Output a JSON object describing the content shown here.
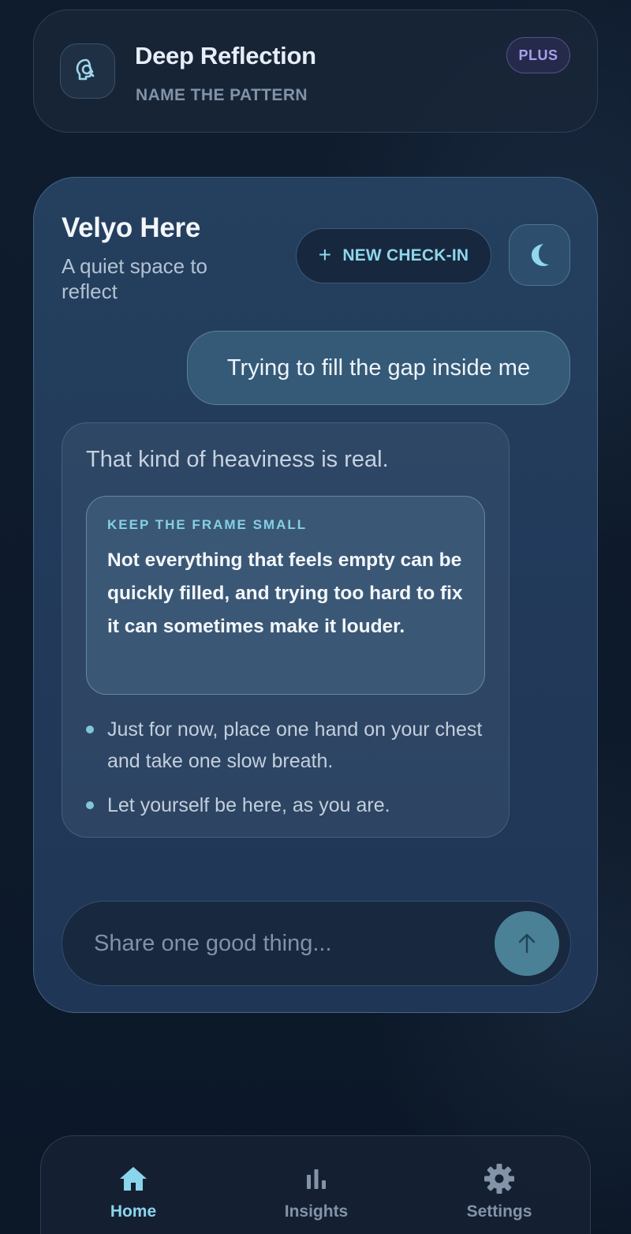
{
  "header": {
    "icon": "brain-search-icon",
    "title": "Deep Reflection",
    "subtitle": "NAME THE PATTERN",
    "badge": "PLUS"
  },
  "chat": {
    "title": "Velyo Here",
    "subtitle": "A quiet space to reflect",
    "new_checkin_label": "NEW CHECK-IN",
    "new_checkin_icon": "plus-icon",
    "theme_toggle_icon": "moon-icon",
    "user_message": "Trying to fill the gap inside me",
    "bot_message": {
      "opening": "That kind of heaviness is real.",
      "frame_label": "KEEP THE FRAME SMALL",
      "frame_text": "Not everything that feels empty can be quickly filled, and trying too hard to fix it can sometimes make it louder.",
      "bullets": [
        "Just for now, place one hand on your chest and take one slow breath.",
        "Let yourself be here, as you are."
      ]
    },
    "composer": {
      "placeholder": "Share one good thing...",
      "send_icon": "arrow-up-icon"
    }
  },
  "nav": {
    "items": [
      {
        "label": "Home",
        "icon": "home-icon",
        "active": true
      },
      {
        "label": "Insights",
        "icon": "bar-chart-icon",
        "active": false
      },
      {
        "label": "Settings",
        "icon": "gear-icon",
        "active": false
      }
    ]
  },
  "colors": {
    "background": "#0d1a2b",
    "card": "#22395a",
    "accent": "#8ed6ec",
    "plus_badge": "#a99ef0",
    "send_button": "#4a8197"
  }
}
